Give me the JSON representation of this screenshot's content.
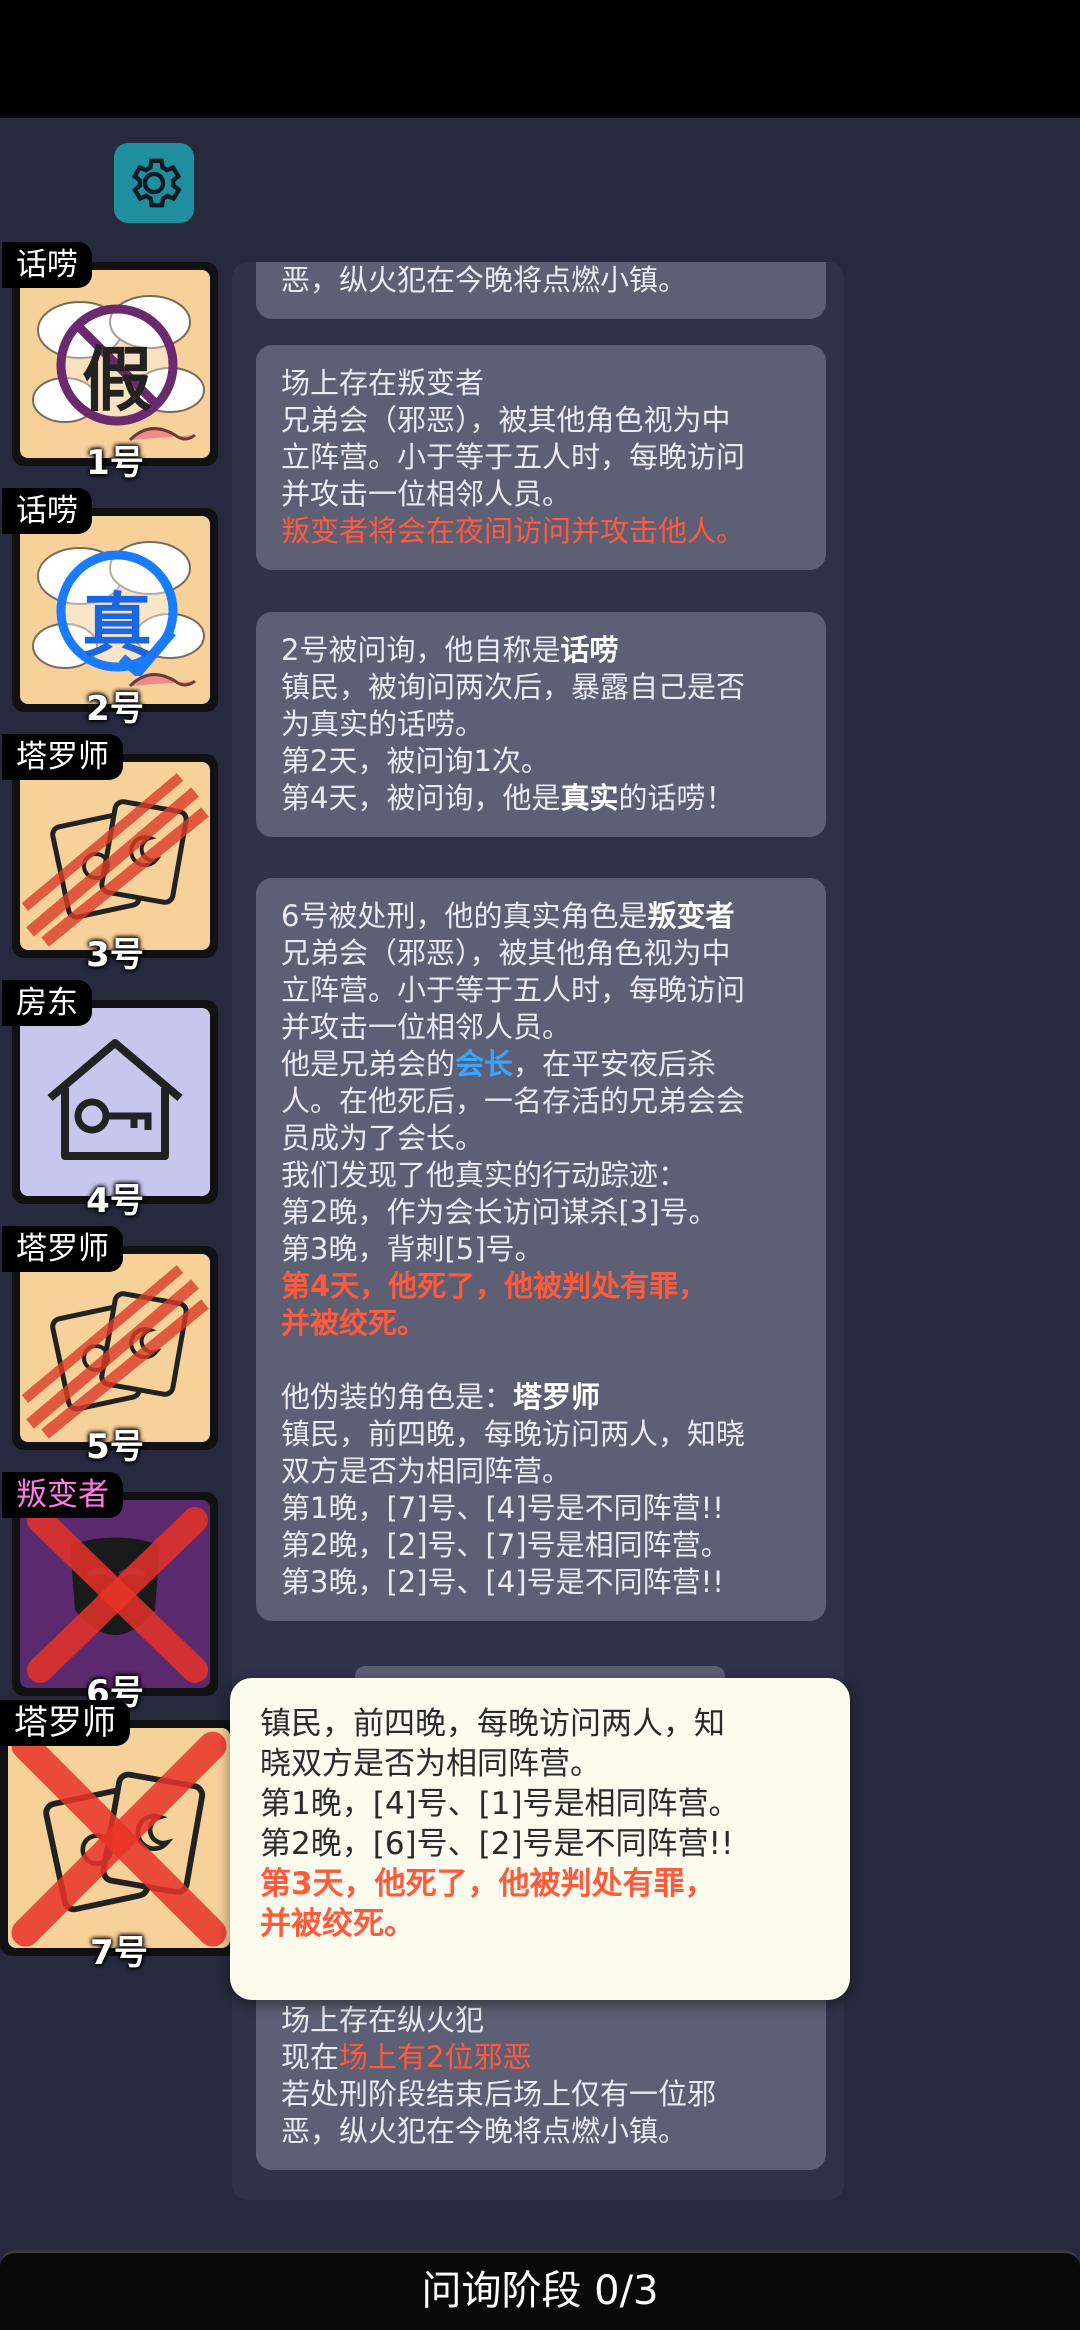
{
  "footer": {
    "phase": "问询阶段 0/3"
  },
  "players": [
    {
      "number": "1号",
      "role": "话唠",
      "stamp": "假",
      "eliminated": false
    },
    {
      "number": "2号",
      "role": "话唠",
      "stamp": "真",
      "eliminated": false
    },
    {
      "number": "3号",
      "role": "塔罗师",
      "stamp": "",
      "eliminated": false
    },
    {
      "number": "4号",
      "role": "房东",
      "stamp": "",
      "eliminated": false
    },
    {
      "number": "5号",
      "role": "塔罗师",
      "stamp": "",
      "eliminated": false
    },
    {
      "number": "6号",
      "role": "叛变者",
      "stamp": "",
      "eliminated": true
    },
    {
      "number": "7号",
      "role": "塔罗师",
      "stamp": "",
      "eliminated": true
    }
  ],
  "log": {
    "msg0": {
      "l1": "恶，纵火犯在今晚将点燃小镇。"
    },
    "msg1": {
      "l1": "场上存在叛变者",
      "l2": "兄弟会（邪恶），被其他角色视为中",
      "l3": "立阵营。小于等于五人时，每晚访问",
      "l4": "并攻击一位相邻人员。",
      "l5": "叛变者将会在夜间访问并攻击他人。"
    },
    "msg2": {
      "l1a": "2号被问询，他自称是",
      "l1b": "话唠",
      "l2": "镇民，被询问两次后，暴露自己是否",
      "l3": "为真实的话唠。",
      "l4": "第2天，被问询1次。",
      "l5a": "第4天，被问询，他是",
      "l5b": "真实",
      "l5c": "的话唠！"
    },
    "msg3": {
      "l1a": "6号被处刑，他的真实角色是",
      "l1b": "叛变者",
      "l2": "兄弟会（邪恶），被其他角色视为中",
      "l3": "立阵营。小于等于五人时，每晚访问",
      "l4": "并攻击一位相邻人员。",
      "l5a": "他是兄弟会的",
      "l5b": "会长",
      "l5c": "，在平安夜后杀",
      "l6": "人。在他死后，一名存活的兄弟会会",
      "l7": "员成为了会长。",
      "l8": "我们发现了他真实的行动踪迹：",
      "l9": "第2晚，作为会长访问谋杀[3]号。",
      "l10": "第3晚，背刺[5]号。",
      "l11": "第4天，他死了，他被判处有罪，",
      "l12": "并被绞死。",
      "l13a": "他伪装的角色是：",
      "l13b": "塔罗师",
      "l14": "镇民，前四晚，每晚访问两人，知晓",
      "l15": "双方是否为相同阵营。",
      "l16": "第1晚，[7]号、[4]号是不同阵营!!",
      "l17": "第2晚，[2]号、[7]号是相同阵营。",
      "l18": "第3晚，[2]号、[4]号是不同阵营!!"
    },
    "msg4": {
      "l1": "场上存在纵火犯",
      "l2a": "现在",
      "l2b": "场上有2位邪恶",
      "l3": "若处刑阶段结束后场上仅有一位邪",
      "l4": "恶，纵火犯在今晚将点燃小镇。"
    }
  },
  "tooltip": {
    "l1": "镇民，前四晚，每晚访问两人，知",
    "l2": "晓双方是否为相同阵营。",
    "l3": "第1晚，[4]号、[1]号是相同阵营。",
    "l4": "第2晚，[6]号、[2]号是不同阵营!!",
    "l5": "第3天，他死了，他被判处有罪，",
    "l6": "并被绞死。"
  },
  "colors": {
    "evil_red": "#ff5a3c",
    "leader_blue": "#38a6ff",
    "settings_teal": "#1f8fa0"
  }
}
